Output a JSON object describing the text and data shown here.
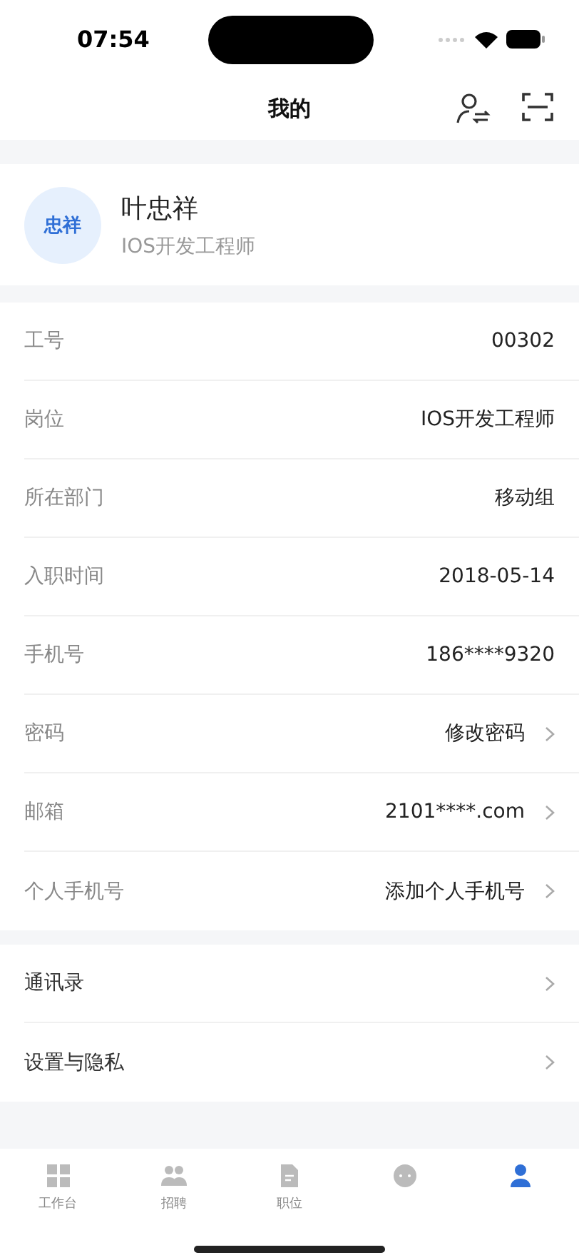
{
  "status_bar": {
    "time": "07:54"
  },
  "nav": {
    "title": "我的"
  },
  "profile": {
    "avatar": "忠祥",
    "name": "叶忠祥",
    "role": "IOS开发工程师"
  },
  "info_rows": [
    {
      "label": "工号",
      "value": "00302",
      "chevron": false
    },
    {
      "label": "岗位",
      "value": "IOS开发工程师",
      "chevron": false
    },
    {
      "label": "所在部门",
      "value": "移动组",
      "chevron": false
    },
    {
      "label": "入职时间",
      "value": "2018-05-14",
      "chevron": false
    },
    {
      "label": "手机号",
      "value": "186****9320",
      "chevron": false
    },
    {
      "label": "密码",
      "value": "修改密码",
      "chevron": true
    },
    {
      "label": "邮箱",
      "value": "2101****.com",
      "chevron": true
    },
    {
      "label": "个人手机号",
      "value": "添加个人手机号",
      "chevron": true
    }
  ],
  "menu_rows": [
    {
      "label": "通讯录"
    },
    {
      "label": "设置与隐私"
    }
  ],
  "tab_bar": [
    {
      "kind": "grid",
      "label": "工作台",
      "selected": false
    },
    {
      "kind": "people",
      "label": "招聘",
      "selected": false
    },
    {
      "kind": "document",
      "label": "职位",
      "selected": false
    },
    {
      "kind": "chat",
      "selected": false
    },
    {
      "kind": "person",
      "selected": true
    }
  ]
}
